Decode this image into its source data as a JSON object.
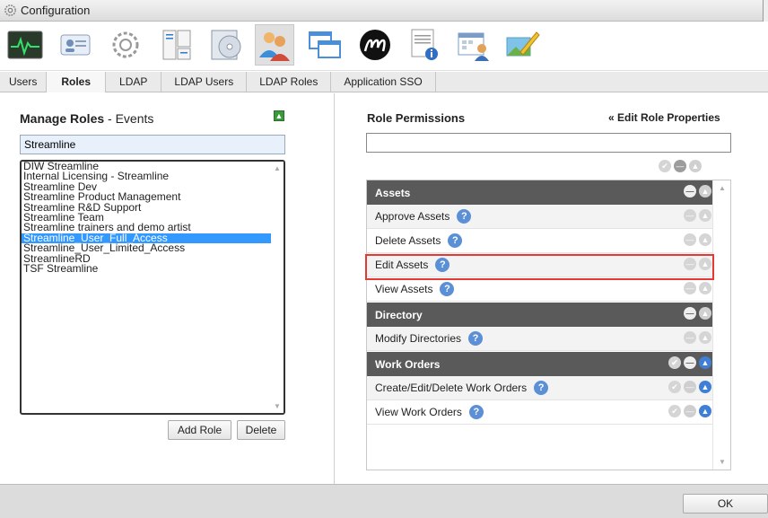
{
  "window": {
    "title": "Configuration"
  },
  "toolbar_icons": [
    "monitor-icon",
    "user-card-icon",
    "gear-icon",
    "server-icon",
    "disc-icon",
    "users-icon",
    "windows-icon",
    "m-logo-icon",
    "document-info-icon",
    "calendar-user-icon",
    "pencil-icon"
  ],
  "tabs": [
    {
      "label": "Users"
    },
    {
      "label": "Roles",
      "active": true
    },
    {
      "label": "LDAP"
    },
    {
      "label": "LDAP Users"
    },
    {
      "label": "LDAP Roles"
    },
    {
      "label": "Application SSO"
    }
  ],
  "manage_roles": {
    "title": "Manage Roles",
    "subtitle": " - Events",
    "search_value": "Streamline",
    "roles": [
      "DIW Streamline",
      "Internal Licensing - Streamline",
      "Streamline Dev",
      "Streamline Product Management",
      "Streamline R&D Support",
      "Streamline Team",
      "Streamline trainers and demo artist",
      "Streamline_User_Full_Access",
      "Streamline_User_Limited_Access",
      "StreamlineRD",
      "TSF Streamline"
    ],
    "selected_role": "Streamline_User_Full_Access",
    "add_label": "Add Role",
    "delete_label": "Delete"
  },
  "role_permissions": {
    "title": "Role Permissions",
    "edit_link": "« Edit Role Properties",
    "search_value": "",
    "rows": [
      {
        "type": "cat",
        "label": "Assets",
        "state": "allow"
      },
      {
        "type": "perm",
        "label": "Approve Assets",
        "state": "allow"
      },
      {
        "type": "perm",
        "label": "Delete Assets",
        "state": "allow"
      },
      {
        "type": "perm",
        "label": "Edit Assets",
        "state": "allow",
        "highlighted": true
      },
      {
        "type": "perm",
        "label": "View Assets",
        "state": "allow"
      },
      {
        "type": "cat",
        "label": "Directory",
        "state": "allow"
      },
      {
        "type": "perm",
        "label": "Modify Directories",
        "state": "allow"
      },
      {
        "type": "cat",
        "label": "Work Orders",
        "state": "inherit"
      },
      {
        "type": "perm",
        "label": "Create/Edit/Delete Work Orders",
        "state": "inherit"
      },
      {
        "type": "perm",
        "label": "View Work Orders",
        "state": "inherit"
      }
    ]
  },
  "footer": {
    "ok_label": "OK"
  },
  "colors": {
    "allow": "#7fc242",
    "inherit": "#3f7fd6",
    "highlight": "#e53935",
    "category_bg": "#5a5a5a"
  }
}
